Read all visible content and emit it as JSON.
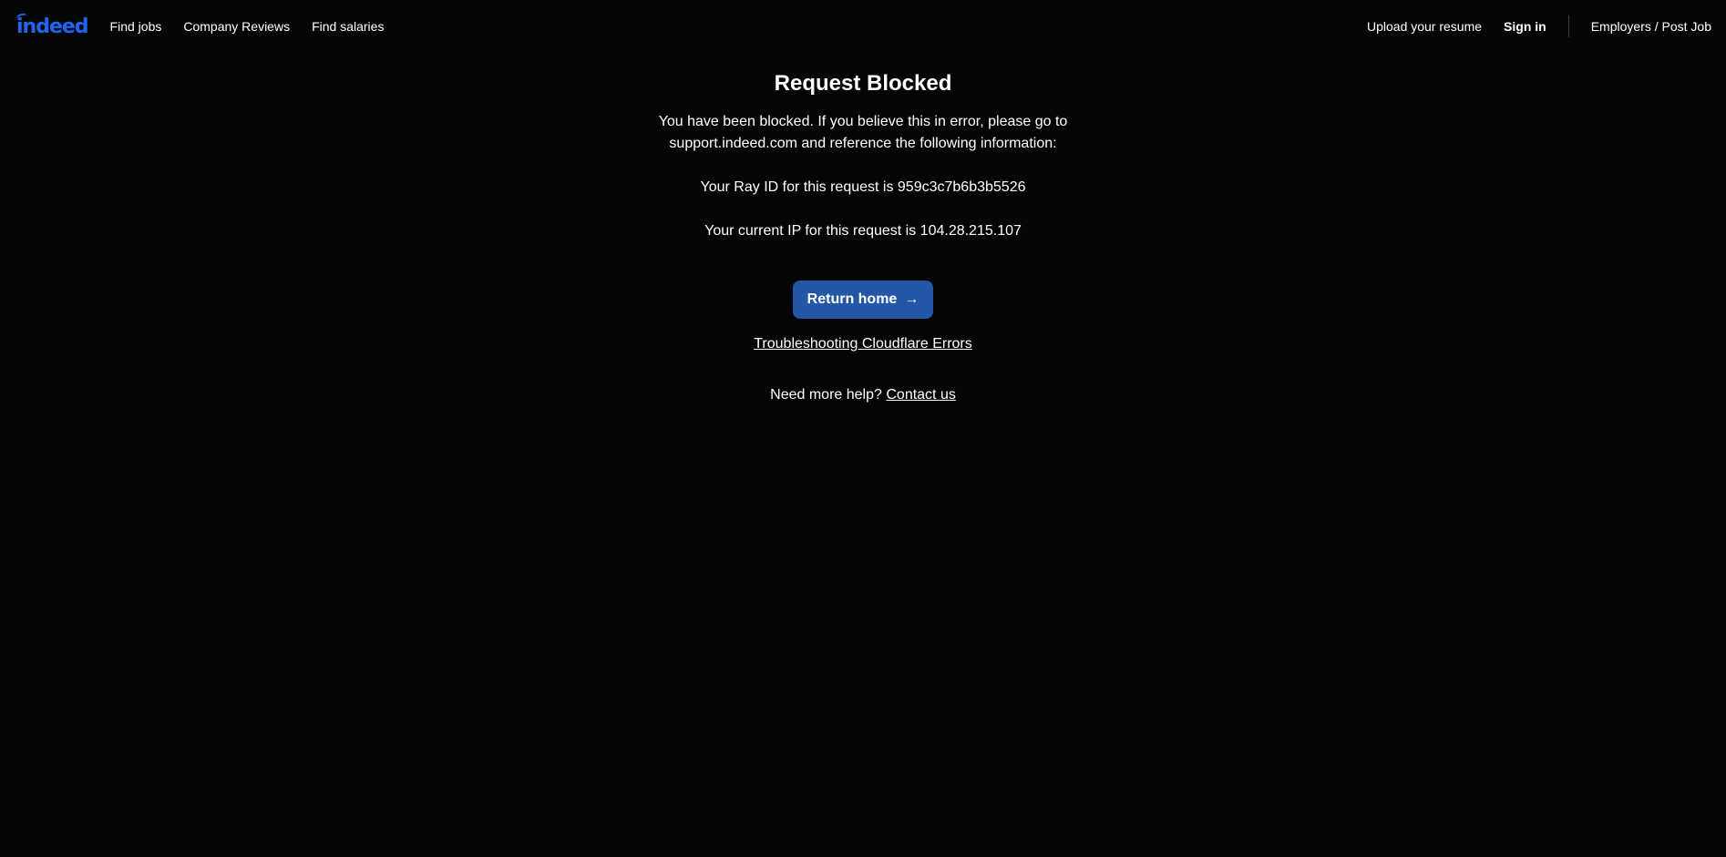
{
  "header": {
    "logo_text": "indeed",
    "nav_left": [
      "Find jobs",
      "Company Reviews",
      "Find salaries"
    ],
    "upload_resume": "Upload your resume",
    "sign_in": "Sign in",
    "employers": "Employers / Post Job"
  },
  "main": {
    "title": "Request Blocked",
    "message": "You have been blocked. If you believe this in error, please go to support.indeed.com and reference the following information:",
    "ray_id_line": "Your Ray ID for this request is 959c3c7b6b3b5526",
    "ip_line": "Your current IP for this request is 104.28.215.107",
    "return_button": "Return home",
    "return_arrow": "→",
    "troubleshoot_link": "Troubleshooting Cloudflare Errors",
    "help_text": "Need more help?",
    "contact_link": "Contact us"
  },
  "colors": {
    "background": "#040606",
    "brand": "#2164f3",
    "button": "#2557a7",
    "text": "#ffffff"
  },
  "icons": {
    "arrow": "arrow-right-icon"
  }
}
